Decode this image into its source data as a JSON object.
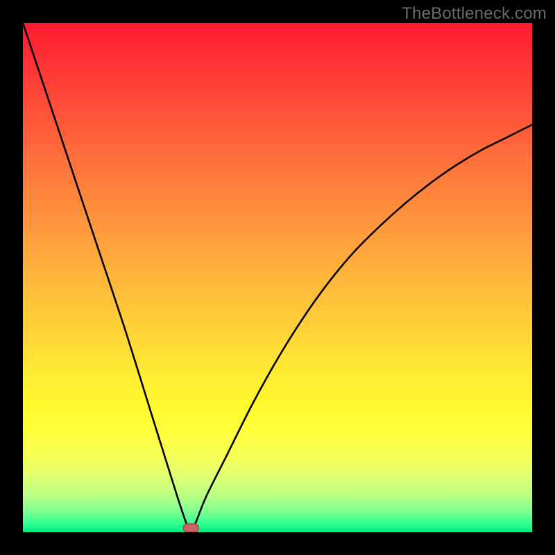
{
  "watermark": {
    "text": "TheBottleneck.com"
  },
  "colors": {
    "frame": "#000000",
    "curve": "#000000",
    "marker_fill": "#c96262",
    "marker_stroke": "#a64b4b",
    "gradient_stops": [
      "#ff1a2e",
      "#ff7a3c",
      "#ffe933",
      "#00e884"
    ]
  },
  "chart_data": {
    "type": "line",
    "title": "",
    "xlabel": "",
    "ylabel": "",
    "xlim": [
      0,
      100
    ],
    "ylim": [
      0,
      100
    ],
    "grid": false,
    "legend": false,
    "annotations": [],
    "description": "V-shaped bottleneck curve overlaid on a red-to-green vertical gradient. Left branch is steep and nearly linear; right branch is concave (rises with decreasing slope). Minimum is at x≈33 where the curve touches y≈0. A small red rounded marker sits at the minimum.",
    "minimum": {
      "x": 33,
      "y": 0
    },
    "marker": {
      "x": 33,
      "y": 0
    },
    "series": [
      {
        "name": "curve",
        "x": [
          0,
          5,
          10,
          15,
          20,
          25,
          30,
          32,
          33,
          34,
          36,
          40,
          45,
          50,
          55,
          60,
          65,
          70,
          75,
          80,
          85,
          90,
          95,
          100
        ],
        "values": [
          100,
          85,
          70,
          55,
          40,
          24,
          8,
          2,
          0,
          2,
          7,
          15,
          25,
          34,
          42,
          49,
          55,
          60,
          64.5,
          68.5,
          72,
          75,
          77.5,
          80
        ]
      }
    ]
  }
}
